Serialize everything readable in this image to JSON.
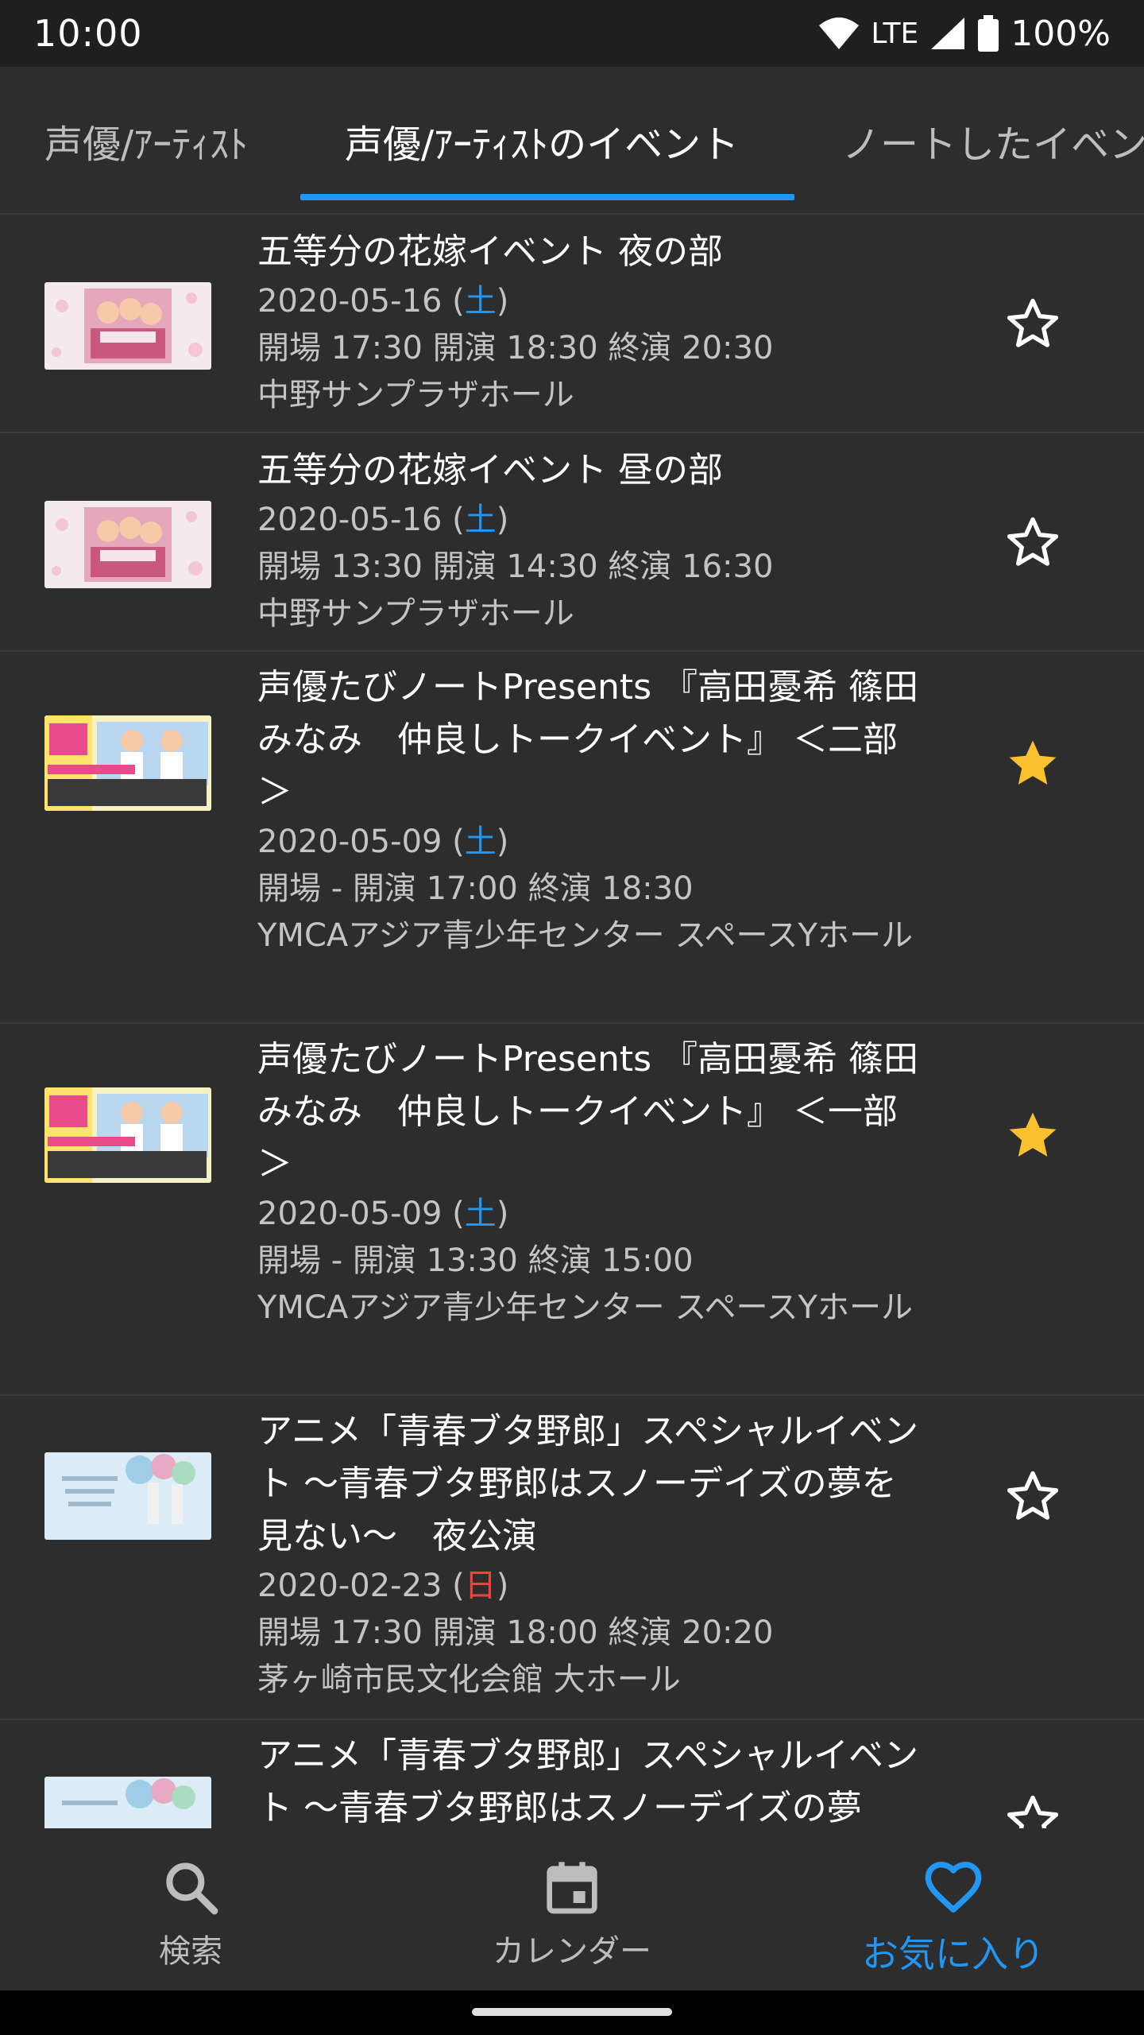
{
  "status": {
    "time": "10:00",
    "network": "LTE",
    "battery": "100%"
  },
  "tabs": [
    {
      "label": "声優/ｱｰﾃｨｽﾄ"
    },
    {
      "label": "声優/ｱｰﾃｨｽﾄのイベント"
    },
    {
      "label": "ノートしたイベント"
    }
  ],
  "events": [
    {
      "title": "五等分の花嫁イベント 夜の部",
      "date": "2020-05-16 (",
      "weekday": "土",
      "date_end": ")",
      "times": "開場 17:30 開演 18:30 終演 20:30",
      "venue": "中野サンプラザホール",
      "favorited": false
    },
    {
      "title": "五等分の花嫁イベント 昼の部",
      "date": "2020-05-16 (",
      "weekday": "土",
      "date_end": ")",
      "times": "開場 13:30 開演 14:30 終演 16:30",
      "venue": "中野サンプラザホール",
      "favorited": false
    },
    {
      "title": "声優たびノートPresents 『高田憂希 篠田みなみ　仲良しトークイベント』 ＜二部＞",
      "date": "2020-05-09 (",
      "weekday": "土",
      "date_end": ")",
      "times": "開場 - 開演 17:00 終演 18:30",
      "venue": "YMCAアジア青少年センター スペースYホール",
      "favorited": true
    },
    {
      "title": "声優たびノートPresents 『高田憂希 篠田みなみ　仲良しトークイベント』 ＜一部＞",
      "date": "2020-05-09 (",
      "weekday": "土",
      "date_end": ")",
      "times": "開場 - 開演 13:30 終演 15:00",
      "venue": "YMCAアジア青少年センター スペースYホール",
      "favorited": true
    },
    {
      "title": "アニメ「青春ブタ野郎」スペシャルイベント 〜青春ブタ野郎はスノーデイズの夢を見ない〜　夜公演",
      "date": "2020-02-23 (",
      "weekday": "日",
      "date_end": ")",
      "times": "開場 17:30 開演 18:00 終演 20:20",
      "venue": "茅ヶ崎市民文化会館 大ホール",
      "favorited": false
    },
    {
      "title": "アニメ「青春ブタ野郎」スペシャルイベント 〜青春ブタ野郎はスノーデイズの夢",
      "favorited": false
    }
  ],
  "bottom_nav": {
    "search": "検索",
    "calendar": "カレンダー",
    "favorites": "お気に入り"
  },
  "colors": {
    "accent": "#2196f3",
    "star_filled": "#fbc02d",
    "saturday": "#2196f3",
    "sunday": "#f44336",
    "background": "#2d2d2d"
  }
}
